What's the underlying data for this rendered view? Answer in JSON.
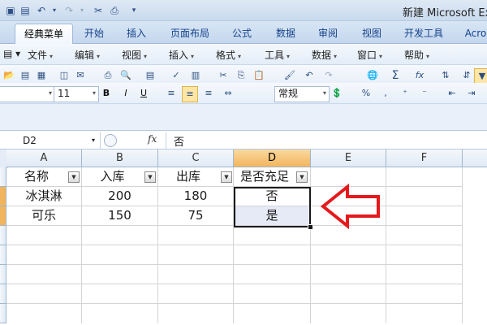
{
  "window": {
    "title": "新建 Microsoft Ex"
  },
  "quick_access": [
    {
      "name": "save-icon",
      "glyph": "💾"
    },
    {
      "name": "undo-icon",
      "glyph": "↶"
    },
    {
      "name": "dropdown-icon",
      "glyph": "▾"
    },
    {
      "name": "redo-icon",
      "glyph": "↷"
    },
    {
      "name": "dropdown-icon",
      "glyph": "▾"
    },
    {
      "name": "format-painter-icon",
      "glyph": "✂"
    },
    {
      "name": "print-icon",
      "glyph": "⎙"
    },
    {
      "name": "customize-icon",
      "glyph": "▾"
    }
  ],
  "tabs": [
    "经典菜单",
    "开始",
    "插入",
    "页面布局",
    "公式",
    "数据",
    "审阅",
    "视图",
    "开发工具",
    "Acro"
  ],
  "menus": [
    "文件",
    "编辑",
    "视图",
    "插入",
    "格式",
    "工具",
    "数据",
    "窗口",
    "帮助"
  ],
  "toolbar": {
    "font_size": "11",
    "bold": "B",
    "italic": "I",
    "underline": "U",
    "number_format": "常规",
    "percent": "%",
    "comma": ",",
    "sum": "Σ",
    "fx": "fx"
  },
  "formula_bar": {
    "cell_ref": "D2",
    "fx_label": "fx",
    "content": "否"
  },
  "sheet": {
    "columns": [
      "A",
      "B",
      "C",
      "D",
      "E",
      "F"
    ],
    "selected_column": "D",
    "headers": [
      "名称",
      "入库",
      "出库",
      "是否充足"
    ],
    "rows": [
      [
        "冰淇淋",
        "200",
        "180",
        "否"
      ],
      [
        "可乐",
        "150",
        "75",
        "是"
      ]
    ]
  },
  "annotation": {
    "shape": "red-arrow",
    "color": "#e5191c",
    "points_to": "D2:D3"
  },
  "colors": {
    "accent": "#f2b55d",
    "ribbon": "#c4d7ee",
    "selection_fill": "#e6e9f6"
  }
}
